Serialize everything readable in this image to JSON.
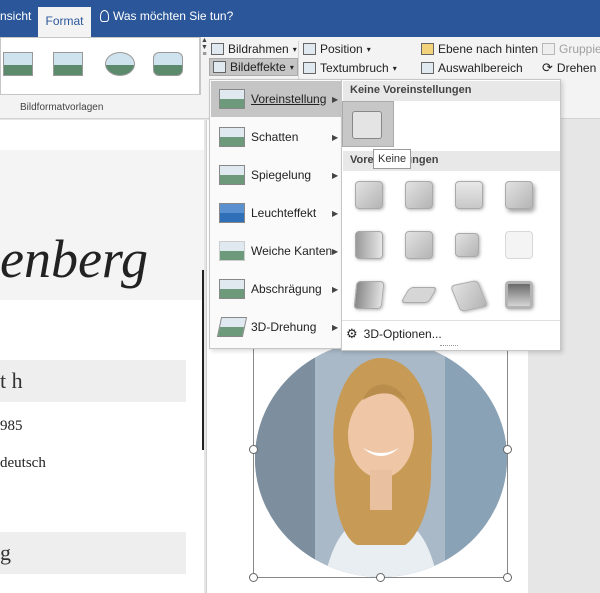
{
  "tabs": {
    "prev": "nsicht",
    "active": "Format",
    "tell_me": "Was möchten Sie tun?"
  },
  "ribbon": {
    "group_label": "Bildformatvorlagen",
    "bildrahmen": "Bildrahmen",
    "bildeffekte": "Bildeffekte",
    "position": "Position",
    "textumbruch": "Textumbruch",
    "ebene_nach_hinten": "Ebene nach hinten",
    "auswahlbereich": "Auswahlbereich",
    "gruppieren": "Gruppier",
    "drehen": "Drehen"
  },
  "effects_menu": {
    "items": [
      "Voreinstellung",
      "Schatten",
      "Spiegelung",
      "Leuchteffekt",
      "Weiche Kanten",
      "Abschrägung",
      "3D-Drehung"
    ],
    "underline": [
      "V",
      "S",
      "p",
      "L",
      "n",
      "b",
      "3"
    ]
  },
  "preset_menu": {
    "no_presets_header": "Keine Voreinstellungen",
    "presets_header": "Voreinstellungen",
    "tooltip": "Keine",
    "options_3d": "3D-Optionen..."
  },
  "document": {
    "name_fragment": "enberg",
    "heading1": "t h",
    "line1": "985",
    "line2": "deutsch",
    "heading2": "g"
  }
}
